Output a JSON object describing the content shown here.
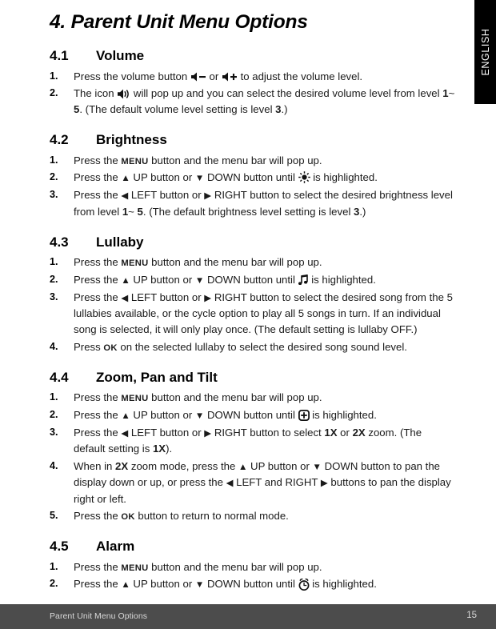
{
  "language_tab": {
    "label": "ENGLISH"
  },
  "chapter": {
    "title": "4. Parent Unit Menu Options"
  },
  "sections": [
    {
      "number": "4.1",
      "name": "Volume",
      "steps": [
        {
          "marker": "1.",
          "parts": [
            {
              "t": "text",
              "v": "Press the volume button "
            },
            {
              "t": "icon",
              "v": "speaker-minus-icon"
            },
            {
              "t": "text",
              "v": " or "
            },
            {
              "t": "icon",
              "v": "speaker-plus-icon"
            },
            {
              "t": "text",
              "v": " to adjust the volume level."
            }
          ]
        },
        {
          "marker": "2.",
          "parts": [
            {
              "t": "text",
              "v": "The icon "
            },
            {
              "t": "icon",
              "v": "speaker-waves-icon"
            },
            {
              "t": "text",
              "v": " will pop up and you can select the desired volume level from level "
            },
            {
              "t": "bold",
              "v": "1"
            },
            {
              "t": "text",
              "v": "~ "
            },
            {
              "t": "bold",
              "v": "5"
            },
            {
              "t": "text",
              "v": ". (The default volume level setting is level "
            },
            {
              "t": "bold",
              "v": "3"
            },
            {
              "t": "text",
              "v": ".)"
            }
          ]
        }
      ]
    },
    {
      "number": "4.2",
      "name": "Brightness",
      "steps": [
        {
          "marker": "1.",
          "parts": [
            {
              "t": "text",
              "v": "Press the "
            },
            {
              "t": "smallcaps",
              "v": "MENU"
            },
            {
              "t": "text",
              "v": " button and the menu bar will pop up."
            }
          ]
        },
        {
          "marker": "2.",
          "parts": [
            {
              "t": "text",
              "v": "Press the "
            },
            {
              "t": "glyph",
              "v": "▲"
            },
            {
              "t": "text",
              "v": " UP button or "
            },
            {
              "t": "glyph",
              "v": "▼"
            },
            {
              "t": "text",
              "v": " DOWN button until "
            },
            {
              "t": "icon",
              "v": "brightness-sun-icon"
            },
            {
              "t": "text",
              "v": " is highlighted."
            }
          ]
        },
        {
          "marker": "3.",
          "parts": [
            {
              "t": "text",
              "v": "Press the "
            },
            {
              "t": "glyph",
              "v": "◀"
            },
            {
              "t": "text",
              "v": " LEFT button or "
            },
            {
              "t": "glyph",
              "v": "▶"
            },
            {
              "t": "text",
              "v": " RIGHT button to select the desired brightness level from level "
            },
            {
              "t": "bold",
              "v": "1"
            },
            {
              "t": "text",
              "v": "~ "
            },
            {
              "t": "bold",
              "v": "5"
            },
            {
              "t": "text",
              "v": ". (The default brightness level setting is level "
            },
            {
              "t": "bold",
              "v": "3"
            },
            {
              "t": "text",
              "v": ".)"
            }
          ]
        }
      ]
    },
    {
      "number": "4.3",
      "name": "Lullaby",
      "steps": [
        {
          "marker": "1.",
          "parts": [
            {
              "t": "text",
              "v": "Press the "
            },
            {
              "t": "smallcaps",
              "v": "MENU"
            },
            {
              "t": "text",
              "v": " button and the menu bar will pop up."
            }
          ]
        },
        {
          "marker": "2.",
          "parts": [
            {
              "t": "text",
              "v": "Press the "
            },
            {
              "t": "glyph",
              "v": "▲"
            },
            {
              "t": "text",
              "v": " UP button or "
            },
            {
              "t": "glyph",
              "v": "▼"
            },
            {
              "t": "text",
              "v": " DOWN button until "
            },
            {
              "t": "icon",
              "v": "music-note-icon"
            },
            {
              "t": "text",
              "v": " is highlighted."
            }
          ]
        },
        {
          "marker": "3.",
          "parts": [
            {
              "t": "text",
              "v": "Press the "
            },
            {
              "t": "glyph",
              "v": "◀"
            },
            {
              "t": "text",
              "v": " LEFT button or "
            },
            {
              "t": "glyph",
              "v": "▶"
            },
            {
              "t": "text",
              "v": " RIGHT button to select the desired song from the 5 lullabies available, or the cycle option to play all 5 songs in turn. If an individual song is selected, it will only play once. (The default setting is lullaby OFF.)"
            }
          ]
        },
        {
          "marker": "4.",
          "parts": [
            {
              "t": "text",
              "v": "Press "
            },
            {
              "t": "smallcaps",
              "v": "OK"
            },
            {
              "t": "text",
              "v": " on the selected lullaby to select the desired song sound level."
            }
          ]
        }
      ]
    },
    {
      "number": "4.4",
      "name": "Zoom, Pan and Tilt",
      "steps": [
        {
          "marker": "1.",
          "parts": [
            {
              "t": "text",
              "v": "Press the "
            },
            {
              "t": "smallcaps",
              "v": "MENU"
            },
            {
              "t": "text",
              "v": " button and the menu bar will pop up."
            }
          ]
        },
        {
          "marker": "2.",
          "parts": [
            {
              "t": "text",
              "v": "Press the "
            },
            {
              "t": "glyph",
              "v": "▲"
            },
            {
              "t": "text",
              "v": " UP button or "
            },
            {
              "t": "glyph",
              "v": "▼"
            },
            {
              "t": "text",
              "v": " DOWN button until "
            },
            {
              "t": "icon",
              "v": "zoom-plus-icon"
            },
            {
              "t": "text",
              "v": " is highlighted."
            }
          ]
        },
        {
          "marker": "3.",
          "parts": [
            {
              "t": "text",
              "v": "Press the "
            },
            {
              "t": "glyph",
              "v": "◀"
            },
            {
              "t": "text",
              "v": " LEFT button or "
            },
            {
              "t": "glyph",
              "v": "▶"
            },
            {
              "t": "text",
              "v": " RIGHT button to select "
            },
            {
              "t": "bold",
              "v": "1X"
            },
            {
              "t": "text",
              "v": " or "
            },
            {
              "t": "bold",
              "v": "2X"
            },
            {
              "t": "text",
              "v": " zoom. (The default setting is "
            },
            {
              "t": "bold",
              "v": "1X"
            },
            {
              "t": "text",
              "v": ")."
            }
          ]
        },
        {
          "marker": "4.",
          "parts": [
            {
              "t": "text",
              "v": "When in "
            },
            {
              "t": "bold",
              "v": "2X"
            },
            {
              "t": "text",
              "v": " zoom mode, press the "
            },
            {
              "t": "glyph",
              "v": "▲"
            },
            {
              "t": "text",
              "v": " UP button or "
            },
            {
              "t": "glyph",
              "v": "▼"
            },
            {
              "t": "text",
              "v": " DOWN button to pan the display down or up, or press the "
            },
            {
              "t": "glyph",
              "v": "◀"
            },
            {
              "t": "text",
              "v": " LEFT and RIGHT  "
            },
            {
              "t": "glyph",
              "v": "▶"
            },
            {
              "t": "text",
              "v": " buttons to pan the display right or left."
            }
          ]
        },
        {
          "marker": "5.",
          "parts": [
            {
              "t": "text",
              "v": "Press the "
            },
            {
              "t": "smallcaps",
              "v": "OK"
            },
            {
              "t": "text",
              "v": " button to return to normal mode."
            }
          ]
        }
      ]
    },
    {
      "number": "4.5",
      "name": "Alarm",
      "steps": [
        {
          "marker": "1.",
          "parts": [
            {
              "t": "text",
              "v": "Press the "
            },
            {
              "t": "smallcaps",
              "v": "MENU"
            },
            {
              "t": "text",
              "v": " button and the menu bar will pop up."
            }
          ]
        },
        {
          "marker": "2.",
          "parts": [
            {
              "t": "text",
              "v": "Press the "
            },
            {
              "t": "glyph",
              "v": "▲"
            },
            {
              "t": "text",
              "v": " UP button or "
            },
            {
              "t": "glyph",
              "v": "▼"
            },
            {
              "t": "text",
              "v": " DOWN button until "
            },
            {
              "t": "icon",
              "v": "alarm-clock-icon"
            },
            {
              "t": "text",
              "v": " is highlighted."
            }
          ]
        }
      ]
    }
  ],
  "footer": {
    "left_label": "Parent Unit Menu Options",
    "page_number": "15",
    "background_color": "#4c4c4c",
    "text_color": "#d8d8d8"
  }
}
